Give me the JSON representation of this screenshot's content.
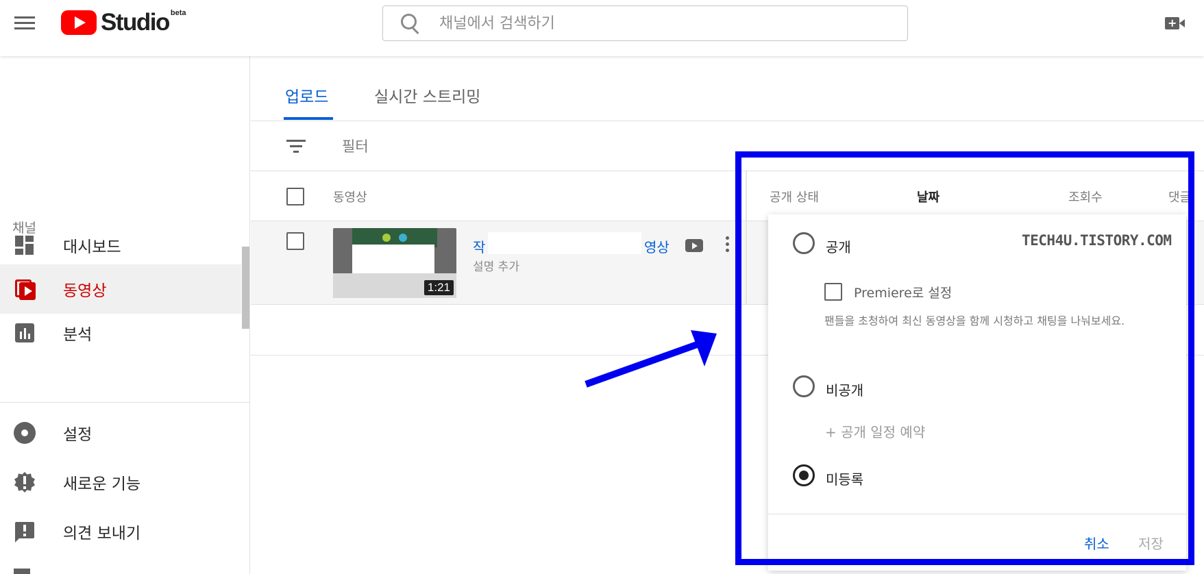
{
  "header": {
    "logo_text": "Studio",
    "logo_badge": "beta",
    "search_placeholder": "채널에서 검색하기"
  },
  "sidebar": {
    "section_label": "채널",
    "items": [
      {
        "label": "대시보드",
        "icon": "dashboard-icon"
      },
      {
        "label": "동영상",
        "icon": "video-library-icon",
        "active": true
      },
      {
        "label": "분석",
        "icon": "analytics-icon"
      },
      {
        "label": "설정",
        "icon": "gear-icon"
      },
      {
        "label": "새로운 기능",
        "icon": "whats-new-icon"
      },
      {
        "label": "의견 보내기",
        "icon": "feedback-icon"
      }
    ]
  },
  "tabs": [
    {
      "label": "업로드",
      "active": true
    },
    {
      "label": "실시간 스트리밍"
    }
  ],
  "filter": {
    "label": "필터"
  },
  "columns": {
    "video": "동영상",
    "visibility": "공개 상태",
    "date": "날짜",
    "views": "조회수",
    "comments": "댓글"
  },
  "video": {
    "title_start": "작",
    "title_end": "영상",
    "description_placeholder": "설명 추가",
    "duration": "1:21"
  },
  "visibility_popup": {
    "watermark": "TECH4U.TISTORY.COM",
    "options": {
      "public": "공개",
      "private": "비공개",
      "unlisted": "미등록"
    },
    "selected": "unlisted",
    "premiere_label": "Premiere로 설정",
    "premiere_description": "팬들을 초청하여 최신 동영상을 함께 시청하고 채팅을 나눠보세요.",
    "schedule_link": "+ 공개 일정 예약",
    "cancel_label": "취소",
    "save_label": "저장"
  },
  "colors": {
    "brand_red": "#ff0000",
    "active_red": "#cc0000",
    "link_blue": "#065fd4",
    "annotation_blue": "#0000f0"
  }
}
